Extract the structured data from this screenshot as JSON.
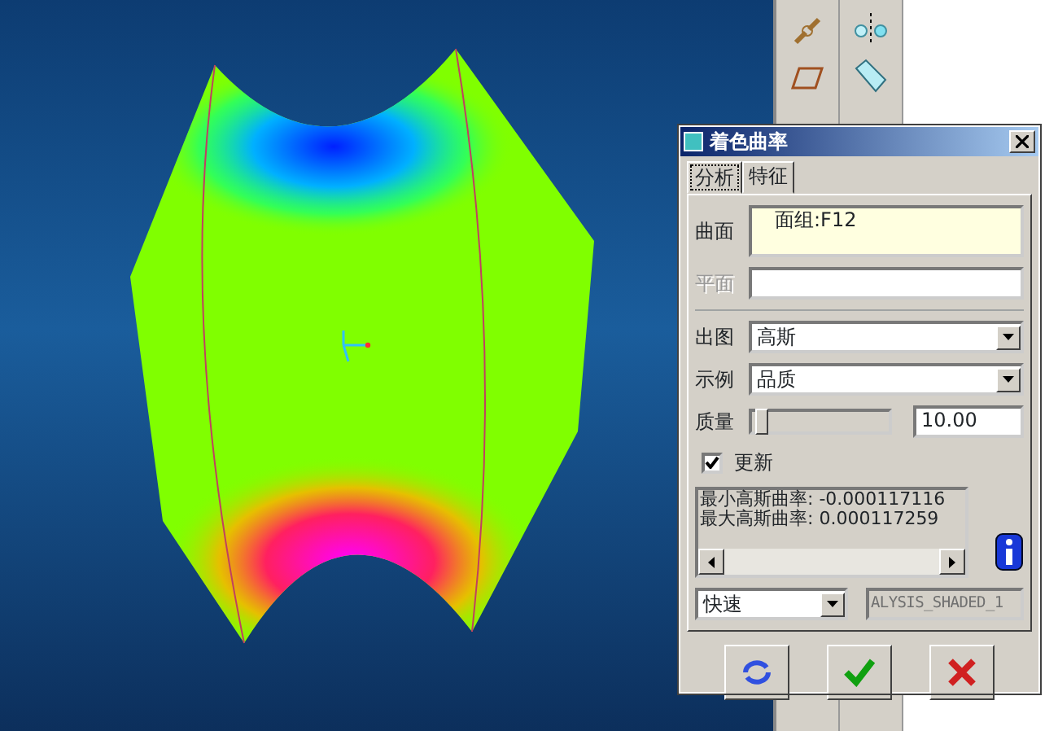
{
  "dialog": {
    "title": "着色曲率",
    "tabs": [
      {
        "label": "分析",
        "selected": true
      },
      {
        "label": "特征",
        "selected": false
      }
    ],
    "surface": {
      "label": "曲面",
      "value": "面组:F12",
      "disabled": false
    },
    "plane": {
      "label": "平面",
      "disabled": true
    },
    "output": {
      "label": "出图",
      "value": "高斯"
    },
    "sample": {
      "label": "示例",
      "value": "品质"
    },
    "quality": {
      "label": "质量",
      "level": 0.03,
      "value": "10.00"
    },
    "update": {
      "label": "更新",
      "checked": true
    },
    "results": [
      "最小高斯曲率: -0.000117116",
      "最大高斯曲率: 0.000117259"
    ],
    "mode": {
      "value": "快速"
    },
    "name_field": {
      "value": "ALYSIS_SHADED_1",
      "disabled": true
    },
    "buttons": [
      {
        "kind": "repaint"
      },
      {
        "kind": "ok"
      },
      {
        "kind": "cancel"
      }
    ]
  }
}
